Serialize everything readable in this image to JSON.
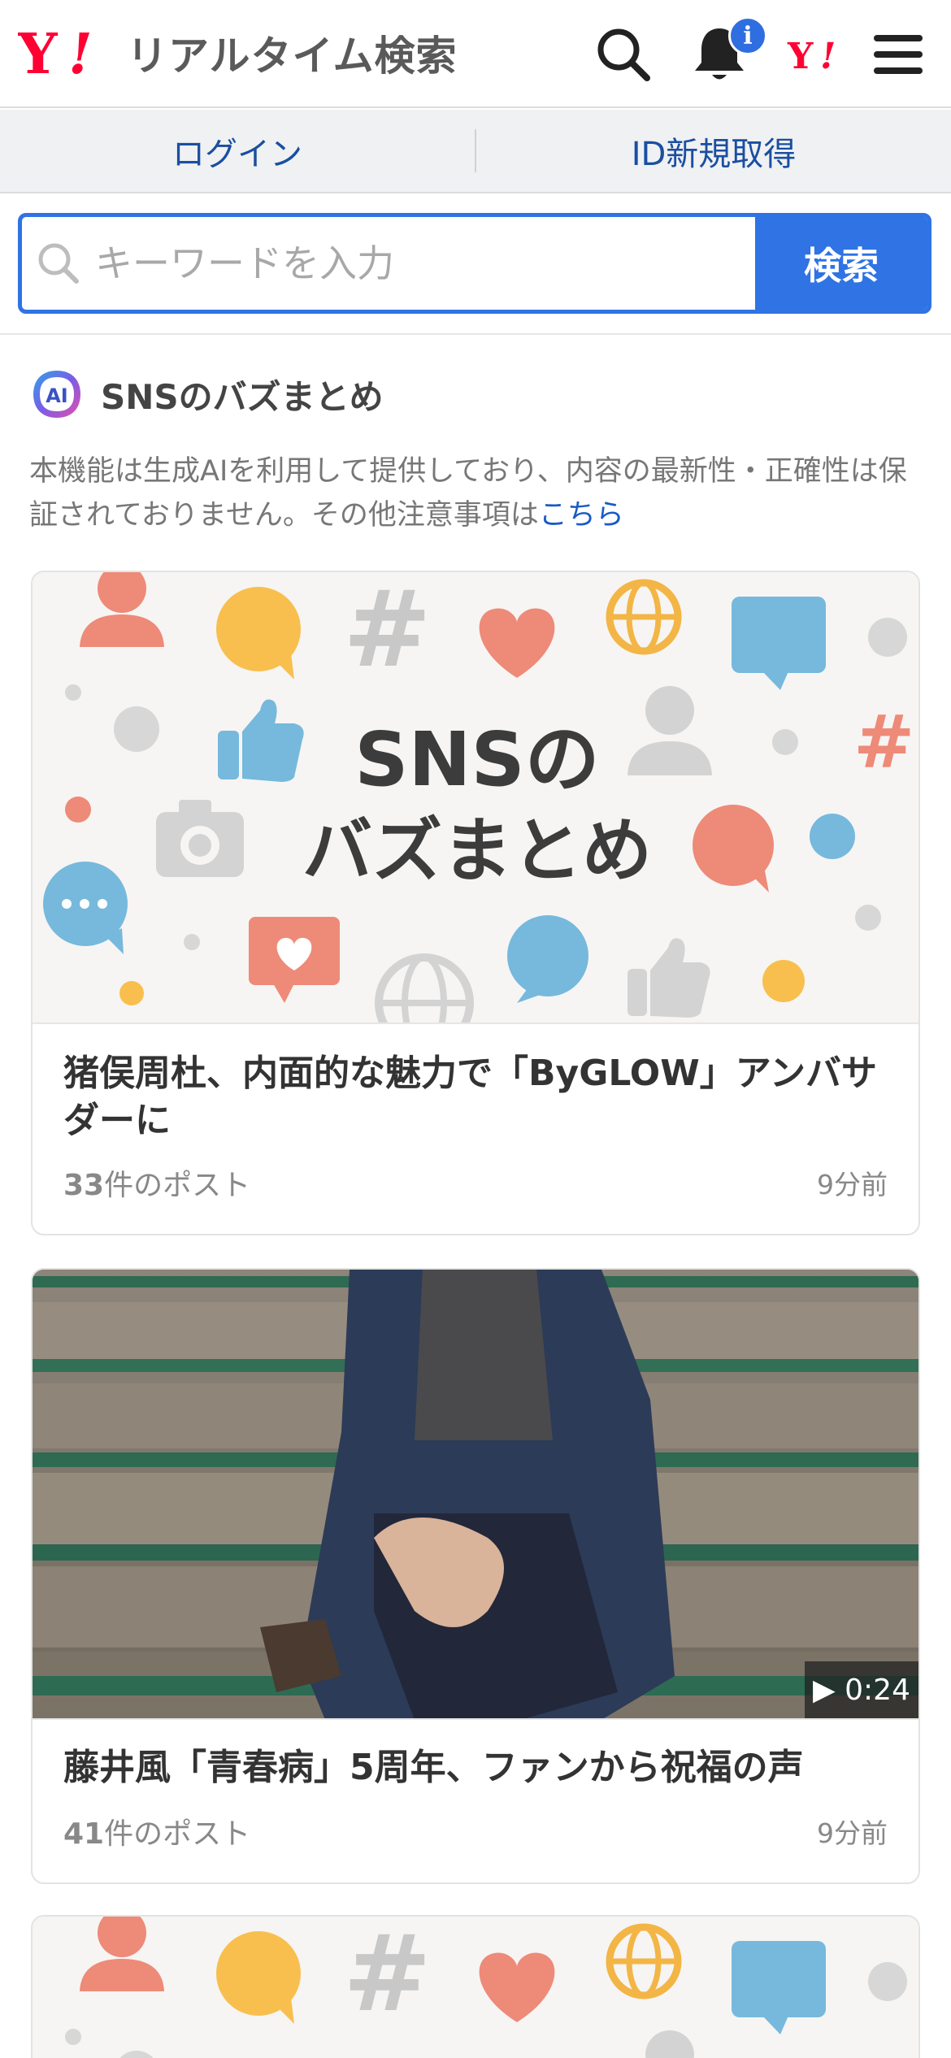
{
  "header": {
    "logo_text": "リアルタイム検索",
    "badge_text": "i"
  },
  "loginbar": {
    "login_label": "ログイン",
    "register_label": "ID新規取得"
  },
  "search": {
    "placeholder": "キーワードを入力",
    "button_label": "検索"
  },
  "section": {
    "badge_text": "AI",
    "title": "SNSのバズまとめ",
    "notice_text": "本機能は生成AIを利用して提供しており、内容の最新性・正確性は保証されておりません。その他注意事項は",
    "notice_link": "こちら"
  },
  "cards": [
    {
      "image_title_line1": "SNSの",
      "image_title_line2": "バズまとめ",
      "title": "猪俣周杜、内面的な魅力で「ByGLOW」アンバサダーに",
      "post_count": "33",
      "post_suffix": "件のポスト",
      "time": "9分前"
    },
    {
      "duration": "▶ 0:24",
      "title": "藤井風「青春病」5周年、ファンから祝福の声",
      "post_count": "41",
      "post_suffix": "件のポスト",
      "time": "9分前"
    }
  ],
  "icons": {
    "search": "search-icon",
    "bell": "bell-icon",
    "yahoo": "yahoo-logo-icon",
    "menu": "hamburger-menu-icon"
  },
  "colors": {
    "accent": "#2f73e4",
    "brand": "#ff0033",
    "link": "#1a4fa0"
  }
}
